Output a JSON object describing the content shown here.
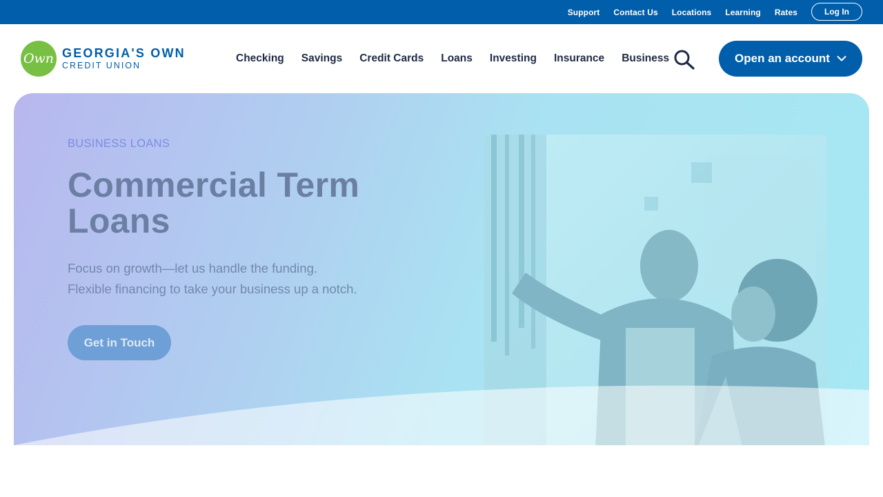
{
  "utility": {
    "links": [
      "Support",
      "Contact Us",
      "Locations",
      "Learning",
      "Rates"
    ],
    "login_label": "Log In"
  },
  "logo": {
    "badge_text": "Own",
    "line1": "GEORGIA'S OWN",
    "line2": "CREDIT UNION"
  },
  "nav": {
    "items": [
      "Checking",
      "Savings",
      "Credit Cards",
      "Loans",
      "Investing",
      "Insurance",
      "Business"
    ],
    "search_icon": "search-icon",
    "open_account_label": "Open an account"
  },
  "hero": {
    "eyebrow": "BUSINESS LOANS",
    "title": "Commercial Term Loans",
    "subtitle_line1": "Focus on growth—let us handle the funding.",
    "subtitle_line2": "Flexible financing to take your business up a notch.",
    "cta_label": "Get in Touch"
  },
  "colors": {
    "brand_blue": "#005eaa",
    "brand_green": "#78c043",
    "nav_text": "#1f2a44",
    "eyebrow": "#7b8de3",
    "title": "#6b7fa3"
  }
}
